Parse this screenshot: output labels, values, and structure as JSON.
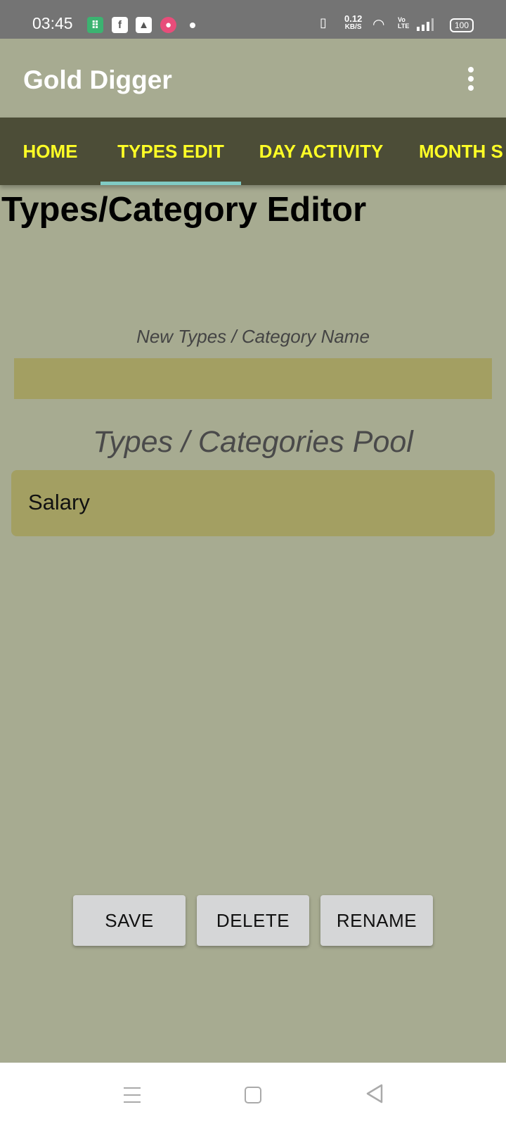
{
  "status_bar": {
    "time": "03:45",
    "network_speed_value": "0.12",
    "network_speed_unit": "KB/S",
    "volte_label": "Vo LTE",
    "battery": "100",
    "icons": [
      "notification-app-icon",
      "facebook-icon",
      "drive-icon",
      "camera-app-icon",
      "vibrate-icon",
      "wifi-icon",
      "signal-icon",
      "battery-icon"
    ]
  },
  "app_bar": {
    "title": "Gold Digger",
    "menu_icon": "more-vertical-icon"
  },
  "tabs": [
    {
      "label": "HOME"
    },
    {
      "label": "TYPES EDIT",
      "selected": true
    },
    {
      "label": "DAY ACTIVITY"
    },
    {
      "label": "MONTH S"
    }
  ],
  "editor": {
    "title": "Types/Category Editor",
    "field_label": "New Types / Category Name",
    "input_value": "",
    "pool_heading": "Types / Categories Pool",
    "pool_items": [
      "Salary"
    ]
  },
  "buttons": {
    "save": "SAVE",
    "delete": "DELETE",
    "rename": "RENAME"
  },
  "colors": {
    "background": "#a7ab91",
    "tab_bar": "#4c4d37",
    "tab_text": "#ffff26",
    "tab_indicator": "#80cbc4",
    "input_fill": "#a39f62",
    "button_fill": "#d5d6d7"
  }
}
